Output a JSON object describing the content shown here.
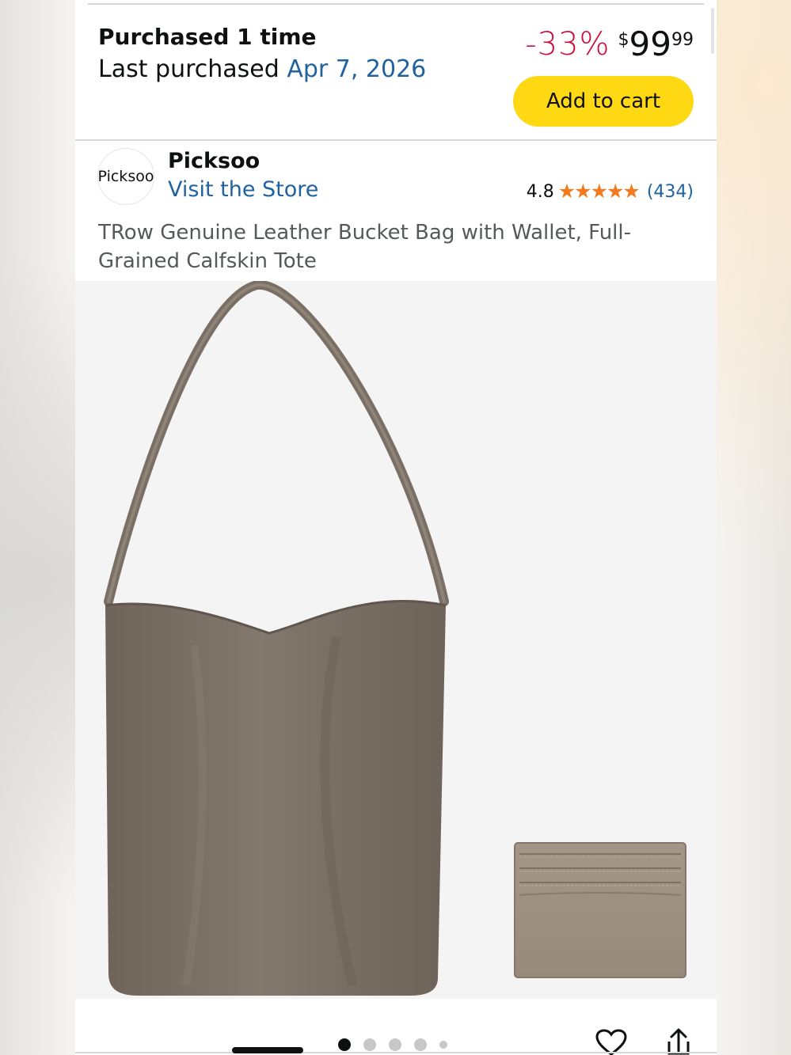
{
  "purchase": {
    "title": "Purchased 1 time",
    "last_label": "Last purchased ",
    "last_date": "Apr 7, 2026"
  },
  "pricing": {
    "discount": "-33%",
    "currency": "$",
    "whole": "99",
    "fraction": "99",
    "add_to_cart": "Add to cart",
    "accent_color": "#ffd814",
    "discount_color": "#cc0c39"
  },
  "store": {
    "logo_text": "Picksoo",
    "brand": "Picksoo",
    "visit": "Visit the Store",
    "rating": "4.8",
    "stars": "★★★★★",
    "rating_value": 4.8,
    "review_count": "(434)"
  },
  "product": {
    "title": "TRow Genuine Leather Bucket Bag with Wallet, Full-Grained Calfskin Tote",
    "image_subjects": [
      "bucket-bag",
      "card-wallet"
    ],
    "leather_color": "#7c7064"
  },
  "carousel": {
    "total": 5,
    "active_index": 0
  },
  "actions": {
    "icons": [
      "heart-icon",
      "share-icon"
    ]
  }
}
